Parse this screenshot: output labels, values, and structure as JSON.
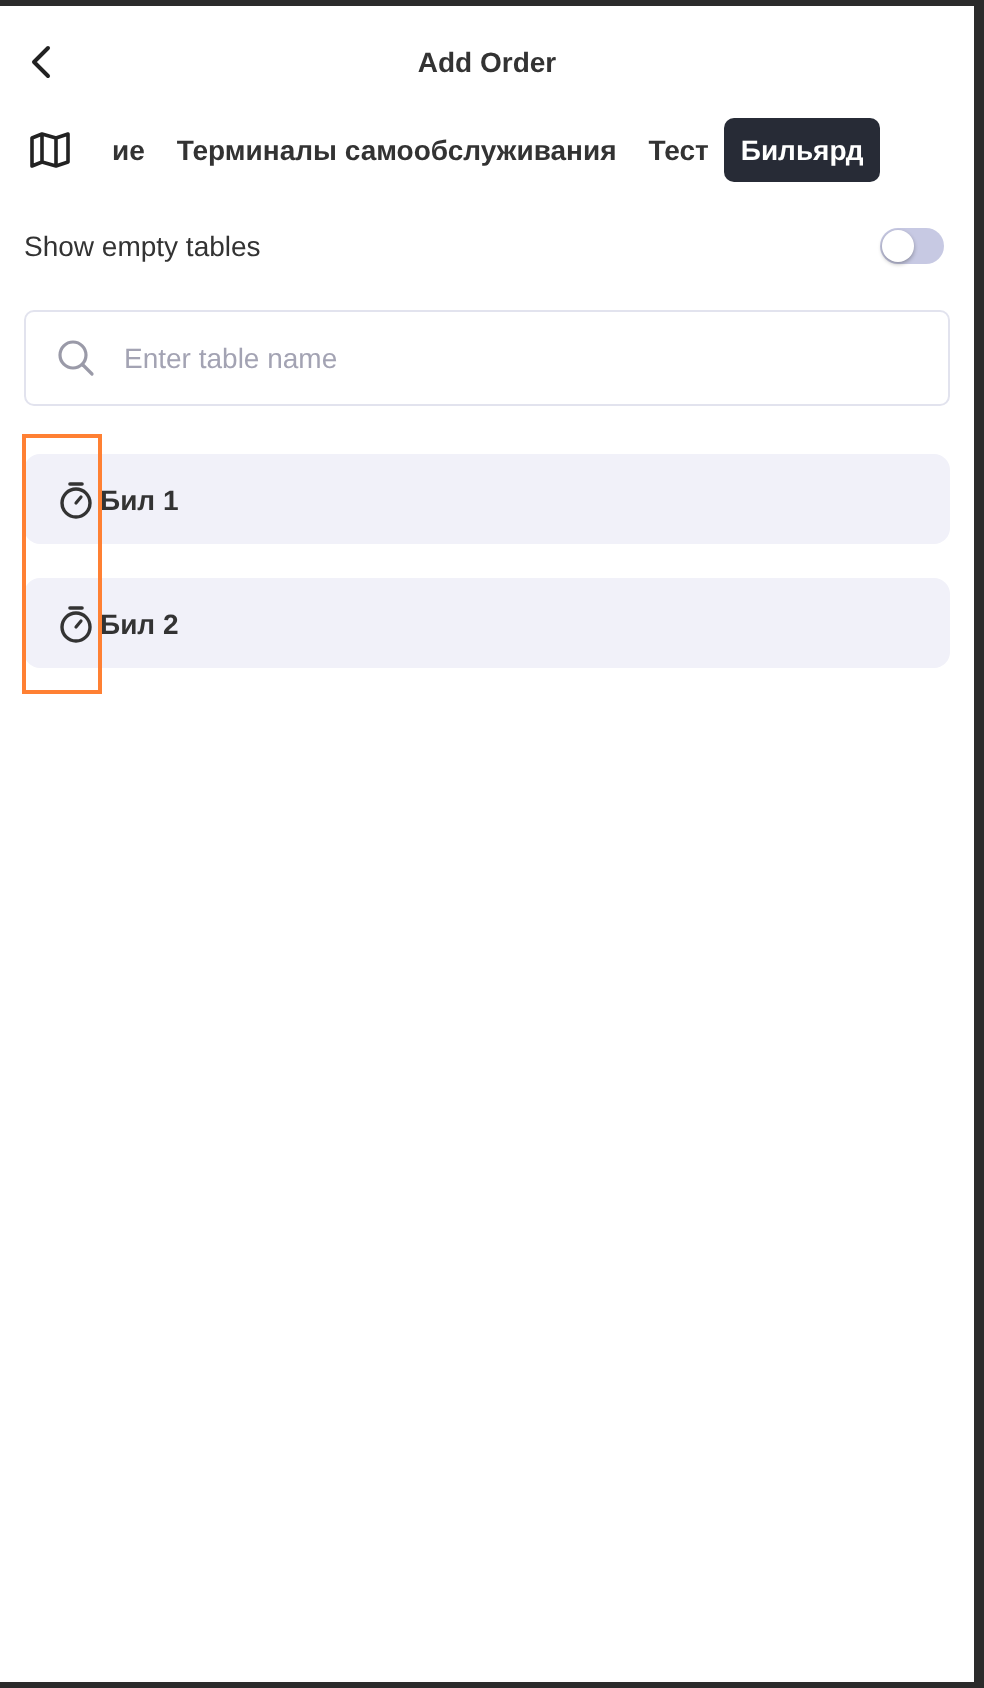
{
  "header": {
    "title": "Add Order"
  },
  "tabs": [
    {
      "label": "ие",
      "selected": false
    },
    {
      "label": "Терминалы самообслуживания",
      "selected": false
    },
    {
      "label": "Тест",
      "selected": false
    },
    {
      "label": "Бильярд",
      "selected": true
    }
  ],
  "show_empty_tables": {
    "label": "Show empty tables",
    "on": false
  },
  "search": {
    "placeholder": "Enter table name"
  },
  "tables": [
    {
      "name": "Бил 1"
    },
    {
      "name": "Бил 2"
    }
  ],
  "annotation": {
    "kind": "highlight"
  }
}
